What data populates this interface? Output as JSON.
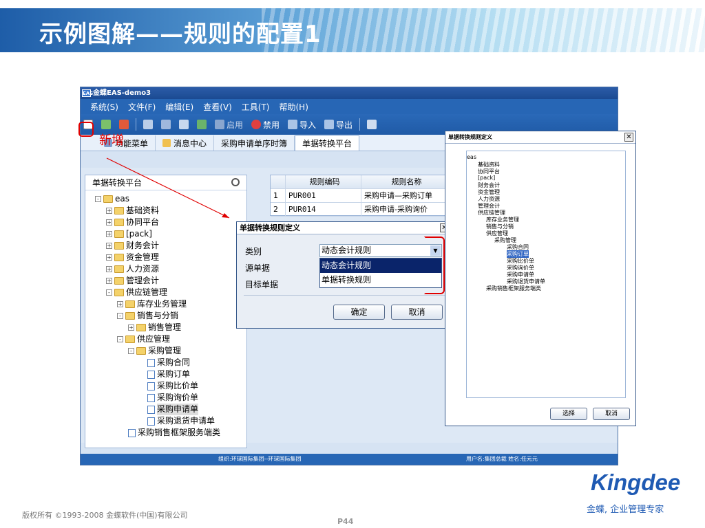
{
  "slide": {
    "title": "示例图解——规则的配置1",
    "copyright": "版权所有 ©1993-2008 金蝶软件(中国)有限公司",
    "page": "P44",
    "brand": "Kingdee",
    "brand_slogan": "金蝶, 企业管理专家",
    "annotation": "新增"
  },
  "app": {
    "title": "金蝶EAS-demo3",
    "icon": "EAS",
    "menu": [
      "系统(S)",
      "文件(F)",
      "编辑(E)",
      "查看(V)",
      "工具(T)",
      "帮助(H)"
    ],
    "toolbar": {
      "enable": "启用",
      "disable": "禁用",
      "import": "导入",
      "export": "导出"
    },
    "tabs": [
      "功能菜单",
      "消息中心",
      "采购申请单序时簿",
      "单据转换平台"
    ],
    "left_panel_title": "单据转换平台",
    "tree": [
      "eas",
      "基础资料",
      "协同平台",
      "[pack]",
      "财务会计",
      "资金管理",
      "人力资源",
      "管理会计",
      "供应链管理",
      "库存业务管理",
      "销售与分销",
      "销售管理",
      "供应管理",
      "采购管理",
      "采购合同",
      "采购订单",
      "采购比价单",
      "采购询价单",
      "采购申请单",
      "采购退货申请单",
      "采购销售框架服务端类"
    ],
    "grid": {
      "headers": [
        "规则编码",
        "规则名称"
      ],
      "rows": [
        [
          "1",
          "PUR001",
          "采购申请—采购订单"
        ],
        [
          "2",
          "PUR014",
          "采购申请-采购询价"
        ]
      ]
    },
    "status": {
      "org": "组织:环球国际集团--环球国际集团",
      "user": "用户名:集团总裁 姓名:任元元"
    }
  },
  "dialog1": {
    "title": "单据转换规则定义",
    "label_category": "类别",
    "label_source": "源单据",
    "label_target": "目标单据",
    "category_value": "动态会计规则",
    "options": [
      "动态会计规则",
      "单据转换规则"
    ],
    "ok": "确定",
    "cancel": "取消"
  },
  "dialog2": {
    "title": "单据转换规则定义",
    "tree": [
      "eas",
      "基础资料",
      "协同平台",
      "[pack]",
      "财务会计",
      "资金管理",
      "人力资源",
      "管理会计",
      "供应链管理",
      "库存业务管理",
      "销售与分销",
      "供应管理",
      "采购管理",
      "采购合同",
      "采购订单",
      "采购比价单",
      "采购询价单",
      "采购申请单",
      "采购退货申请单",
      "采购销售框架服务端类"
    ],
    "select": "选择",
    "cancel": "取消"
  }
}
